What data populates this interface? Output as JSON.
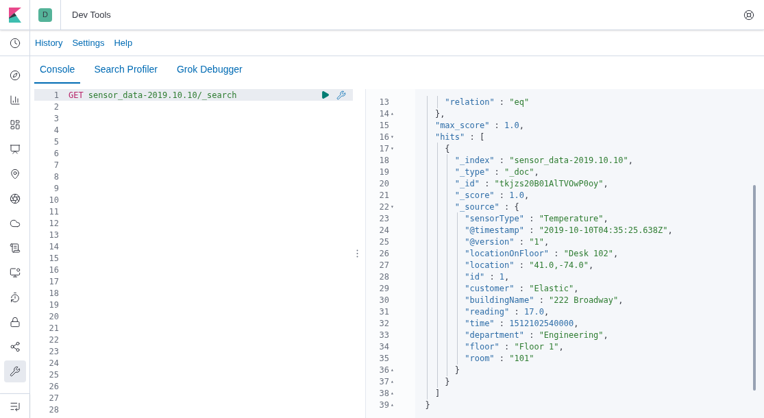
{
  "header": {
    "avatar": "D",
    "title": "Dev Tools"
  },
  "sidebar": {
    "items": [
      {
        "selected": false
      },
      {
        "selected": false
      },
      {
        "selected": false
      },
      {
        "selected": false
      },
      {
        "selected": false
      },
      {
        "selected": false
      },
      {
        "selected": false
      },
      {
        "selected": false
      },
      {
        "selected": false
      },
      {
        "selected": false
      },
      {
        "selected": false
      },
      {
        "selected": false
      },
      {
        "selected": false
      },
      {
        "selected": true
      },
      {
        "selected": false
      }
    ]
  },
  "menu": [
    "History",
    "Settings",
    "Help"
  ],
  "tabs": [
    {
      "label": "Console",
      "selected": true
    },
    {
      "label": "Search Profiler",
      "selected": false
    },
    {
      "label": "Grok Debugger",
      "selected": false
    }
  ],
  "request_editor": {
    "lines": [
      {
        "number": "1",
        "selected": true,
        "tokens": [
          {
            "kind": "method",
            "text": "GET"
          },
          {
            "kind": "url",
            "text": "sensor_data-2019.10.10/_search"
          }
        ]
      },
      {
        "number": "2",
        "selected": false
      },
      {
        "number": "3",
        "selected": false
      },
      {
        "number": "4",
        "selected": false
      },
      {
        "number": "5",
        "selected": false
      },
      {
        "number": "6",
        "selected": false
      },
      {
        "number": "7",
        "selected": false
      },
      {
        "number": "8",
        "selected": false
      },
      {
        "number": "9",
        "selected": false
      },
      {
        "number": "10",
        "selected": false
      },
      {
        "number": "11",
        "selected": false
      },
      {
        "number": "12",
        "selected": false
      },
      {
        "number": "13",
        "selected": false
      },
      {
        "number": "14",
        "selected": false
      },
      {
        "number": "15",
        "selected": false
      },
      {
        "number": "16",
        "selected": false
      },
      {
        "number": "17",
        "selected": false
      },
      {
        "number": "18",
        "selected": false
      },
      {
        "number": "19",
        "selected": false
      },
      {
        "number": "20",
        "selected": false
      },
      {
        "number": "21",
        "selected": false
      },
      {
        "number": "22",
        "selected": false
      },
      {
        "number": "23",
        "selected": false
      },
      {
        "number": "24",
        "selected": false
      },
      {
        "number": "25",
        "selected": false
      },
      {
        "number": "26",
        "selected": false
      },
      {
        "number": "27",
        "selected": false
      },
      {
        "number": "28",
        "selected": false
      }
    ]
  },
  "response_viewer": {
    "lines": [
      {
        "number": "13",
        "tokens": [
          {
            "kind": "key",
            "text": "      \"relation\""
          },
          {
            "kind": "punct",
            "text": " : "
          },
          {
            "kind": "string",
            "text": "\"eq\""
          }
        ]
      },
      {
        "number": "14",
        "fold": "▴",
        "tokens": [
          {
            "kind": "punct",
            "text": "    },"
          }
        ]
      },
      {
        "number": "15",
        "tokens": [
          {
            "kind": "key",
            "text": "    \"max_score\""
          },
          {
            "kind": "punct",
            "text": " : "
          },
          {
            "kind": "number",
            "text": "1.0"
          },
          {
            "kind": "punct",
            "text": ","
          }
        ]
      },
      {
        "number": "16",
        "fold": "▾",
        "tokens": [
          {
            "kind": "key",
            "text": "    \"hits\""
          },
          {
            "kind": "punct",
            "text": " : ["
          }
        ]
      },
      {
        "number": "17",
        "fold": "▾",
        "tokens": [
          {
            "kind": "punct",
            "text": "      {"
          }
        ]
      },
      {
        "number": "18",
        "tokens": [
          {
            "kind": "key",
            "text": "        \"_index\""
          },
          {
            "kind": "punct",
            "text": " : "
          },
          {
            "kind": "string",
            "text": "\"sensor_data-2019.10.10\""
          },
          {
            "kind": "punct",
            "text": ","
          }
        ]
      },
      {
        "number": "19",
        "tokens": [
          {
            "kind": "key",
            "text": "        \"_type\""
          },
          {
            "kind": "punct",
            "text": " : "
          },
          {
            "kind": "string",
            "text": "\"_doc\""
          },
          {
            "kind": "punct",
            "text": ","
          }
        ]
      },
      {
        "number": "20",
        "tokens": [
          {
            "kind": "key",
            "text": "        \"_id\""
          },
          {
            "kind": "punct",
            "text": " : "
          },
          {
            "kind": "string",
            "text": "\"tkjzs20B01AlTVOwP0oy\""
          },
          {
            "kind": "punct",
            "text": ","
          }
        ]
      },
      {
        "number": "21",
        "tokens": [
          {
            "kind": "key",
            "text": "        \"_score\""
          },
          {
            "kind": "punct",
            "text": " : "
          },
          {
            "kind": "number",
            "text": "1.0"
          },
          {
            "kind": "punct",
            "text": ","
          }
        ]
      },
      {
        "number": "22",
        "fold": "▾",
        "tokens": [
          {
            "kind": "key",
            "text": "        \"_source\""
          },
          {
            "kind": "punct",
            "text": " : {"
          }
        ]
      },
      {
        "number": "23",
        "tokens": [
          {
            "kind": "key",
            "text": "          \"sensorType\""
          },
          {
            "kind": "punct",
            "text": " : "
          },
          {
            "kind": "string",
            "text": "\"Temperature\""
          },
          {
            "kind": "punct",
            "text": ","
          }
        ]
      },
      {
        "number": "24",
        "tokens": [
          {
            "kind": "key",
            "text": "          \"@timestamp\""
          },
          {
            "kind": "punct",
            "text": " : "
          },
          {
            "kind": "string",
            "text": "\"2019-10-10T04:35:25.638Z\""
          },
          {
            "kind": "punct",
            "text": ","
          }
        ]
      },
      {
        "number": "25",
        "tokens": [
          {
            "kind": "key",
            "text": "          \"@version\""
          },
          {
            "kind": "punct",
            "text": " : "
          },
          {
            "kind": "string",
            "text": "\"1\""
          },
          {
            "kind": "punct",
            "text": ","
          }
        ]
      },
      {
        "number": "26",
        "tokens": [
          {
            "kind": "key",
            "text": "          \"locationOnFloor\""
          },
          {
            "kind": "punct",
            "text": " : "
          },
          {
            "kind": "string",
            "text": "\"Desk 102\""
          },
          {
            "kind": "punct",
            "text": ","
          }
        ]
      },
      {
        "number": "27",
        "tokens": [
          {
            "kind": "key",
            "text": "          \"location\""
          },
          {
            "kind": "punct",
            "text": " : "
          },
          {
            "kind": "string",
            "text": "\"41.0,-74.0\""
          },
          {
            "kind": "punct",
            "text": ","
          }
        ]
      },
      {
        "number": "28",
        "tokens": [
          {
            "kind": "key",
            "text": "          \"id\""
          },
          {
            "kind": "punct",
            "text": " : "
          },
          {
            "kind": "number",
            "text": "1"
          },
          {
            "kind": "punct",
            "text": ","
          }
        ]
      },
      {
        "number": "29",
        "tokens": [
          {
            "kind": "key",
            "text": "          \"customer\""
          },
          {
            "kind": "punct",
            "text": " : "
          },
          {
            "kind": "string",
            "text": "\"Elastic\""
          },
          {
            "kind": "punct",
            "text": ","
          }
        ]
      },
      {
        "number": "30",
        "tokens": [
          {
            "kind": "key",
            "text": "          \"buildingName\""
          },
          {
            "kind": "punct",
            "text": " : "
          },
          {
            "kind": "string",
            "text": "\"222 Broadway\""
          },
          {
            "kind": "punct",
            "text": ","
          }
        ]
      },
      {
        "number": "31",
        "tokens": [
          {
            "kind": "key",
            "text": "          \"reading\""
          },
          {
            "kind": "punct",
            "text": " : "
          },
          {
            "kind": "number",
            "text": "17.0"
          },
          {
            "kind": "punct",
            "text": ","
          }
        ]
      },
      {
        "number": "32",
        "tokens": [
          {
            "kind": "key",
            "text": "          \"time\""
          },
          {
            "kind": "punct",
            "text": " : "
          },
          {
            "kind": "number",
            "text": "1512102540000"
          },
          {
            "kind": "punct",
            "text": ","
          }
        ]
      },
      {
        "number": "33",
        "tokens": [
          {
            "kind": "key",
            "text": "          \"department\""
          },
          {
            "kind": "punct",
            "text": " : "
          },
          {
            "kind": "string",
            "text": "\"Engineering\""
          },
          {
            "kind": "punct",
            "text": ","
          }
        ]
      },
      {
        "number": "34",
        "tokens": [
          {
            "kind": "key",
            "text": "          \"floor\""
          },
          {
            "kind": "punct",
            "text": " : "
          },
          {
            "kind": "string",
            "text": "\"Floor 1\""
          },
          {
            "kind": "punct",
            "text": ","
          }
        ]
      },
      {
        "number": "35",
        "tokens": [
          {
            "kind": "key",
            "text": "          \"room\""
          },
          {
            "kind": "punct",
            "text": " : "
          },
          {
            "kind": "string",
            "text": "\"101\""
          }
        ]
      },
      {
        "number": "36",
        "fold": "▴",
        "tokens": [
          {
            "kind": "punct",
            "text": "        }"
          }
        ]
      },
      {
        "number": "37",
        "fold": "▴",
        "tokens": [
          {
            "kind": "punct",
            "text": "      }"
          }
        ]
      },
      {
        "number": "38",
        "fold": "▴",
        "tokens": [
          {
            "kind": "punct",
            "text": "    ]"
          }
        ]
      },
      {
        "number": "39",
        "fold": "▴",
        "tokens": [
          {
            "kind": "punct",
            "text": "  }"
          }
        ]
      }
    ]
  }
}
